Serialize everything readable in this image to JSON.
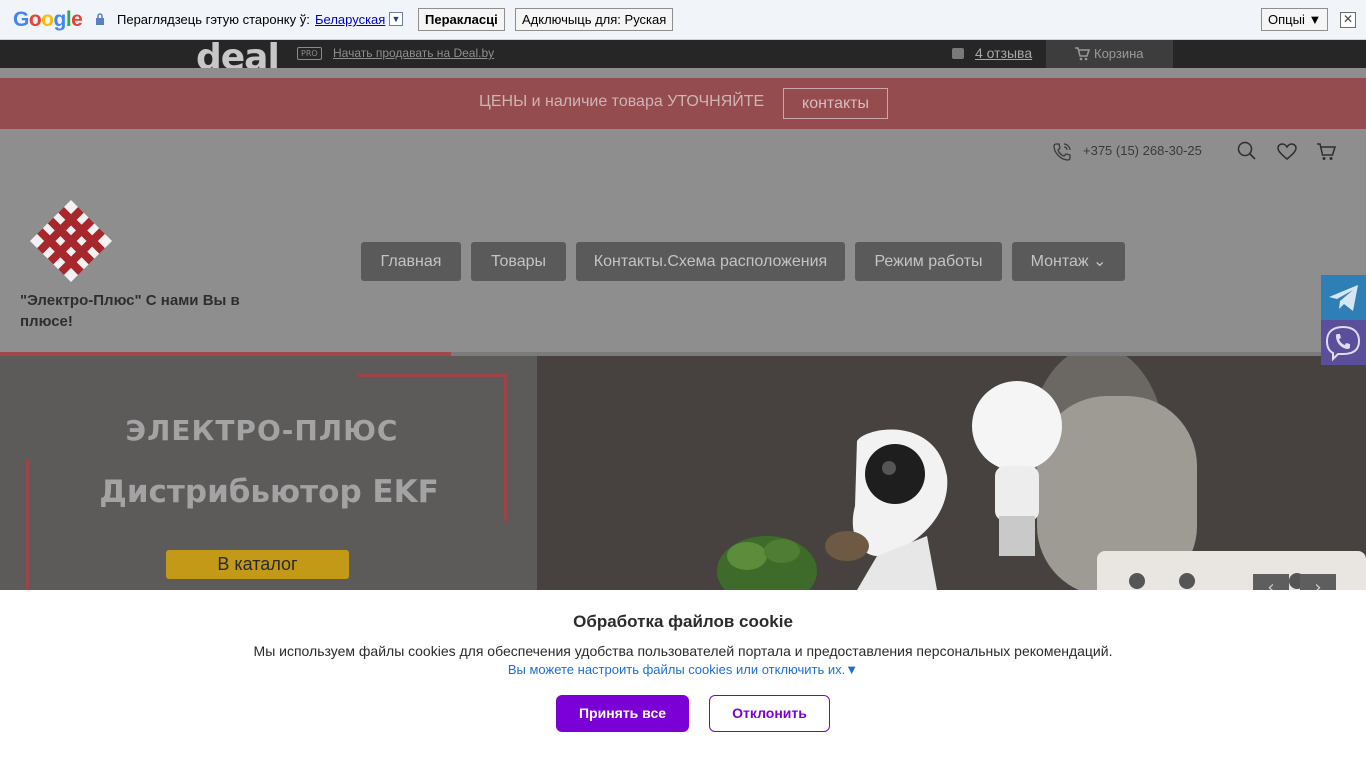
{
  "translate_bar": {
    "logo": "Google",
    "prompt": "Пераглядзець гэтую старонку ў:",
    "language": "Беларуская",
    "language_arrow": "▼",
    "translate_button": "Перакласці",
    "turn_off_button": "Адключыць для: Руская",
    "options_button": "Опцыі ▼",
    "close": "✕"
  },
  "deal_bar": {
    "logo": "deal",
    "pro_badge": "PRO",
    "sell_link": "Начать продавать на Deal.by",
    "reviews_link": "4 отзыва",
    "cart_label": "Корзина"
  },
  "notice": {
    "text": "ЦЕНЫ и наличие товара УТОЧНЯЙТЕ",
    "button": "контакты"
  },
  "header": {
    "phone": "+375 (15) 268-30-25",
    "brand": "\"Электро-Плюс\" С нами Вы в плюсе!",
    "nav": [
      {
        "label": "Главная"
      },
      {
        "label": "Товары"
      },
      {
        "label": "Контакты.Схема расположения"
      },
      {
        "label": "Режим работы"
      },
      {
        "label": "Монтаж ⌄"
      }
    ]
  },
  "slider": {
    "progress_percent": 33,
    "title": "ЭЛЕКТРО-ПЛЮС",
    "subtitle": "Дистрибьютор EKF",
    "cta": "В каталог",
    "prev": "‹",
    "next": "›"
  },
  "cookie": {
    "title": "Обработка файлов cookie",
    "text": "Мы используем файлы cookies для обеспечения удобства пользователей портала и предоставления персональных рекомендаций.",
    "settings_link": "Вы можете настроить файлы cookies или отключить их.▼",
    "accept": "Принять все",
    "decline": "Отклонить"
  },
  "colors": {
    "accent_red": "#954c4f",
    "cookie_purple": "#7a00d6",
    "telegram": "#2f7fb7",
    "viber": "#5b4f9c"
  }
}
